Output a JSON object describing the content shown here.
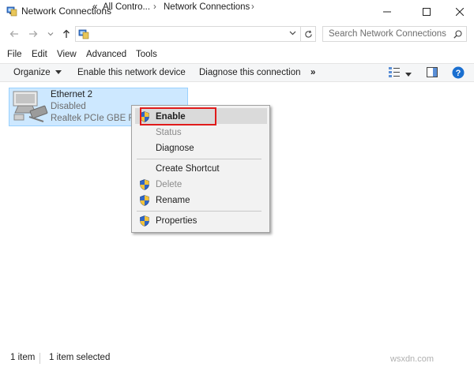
{
  "window": {
    "title": "Network Connections"
  },
  "address": {
    "prefix": "«",
    "segment1": "All Contro...",
    "segment2": "Network Connections",
    "separator": "›"
  },
  "search": {
    "placeholder": "Search Network Connections"
  },
  "menu": {
    "file": "File",
    "edit": "Edit",
    "view": "View",
    "advanced": "Advanced",
    "tools": "Tools"
  },
  "toolbar": {
    "organize": "Organize",
    "enable_device": "Enable this network device",
    "diagnose": "Diagnose this connection",
    "more": "»"
  },
  "item": {
    "name": "Ethernet 2",
    "status": "Disabled",
    "adapter": "Realtek PCIe GBE Family Controller"
  },
  "context_menu": {
    "enable": "Enable",
    "status": "Status",
    "diagnose": "Diagnose",
    "create_shortcut": "Create Shortcut",
    "delete": "Delete",
    "rename": "Rename",
    "properties": "Properties"
  },
  "statusbar": {
    "count": "1 item",
    "selected": "1 item selected"
  },
  "watermark": "wsxdn.com",
  "colors": {
    "selection": "#cde8ff",
    "highlight_box": "#e01b1b",
    "help": "#1a6fd0"
  }
}
